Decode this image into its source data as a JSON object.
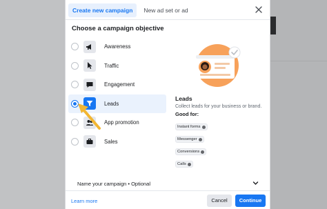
{
  "tabs": [
    {
      "label": "Create new campaign",
      "active": true
    },
    {
      "label": "New ad set or ad",
      "active": false
    }
  ],
  "section_title": "Choose a campaign objective",
  "objectives": [
    {
      "label": "Awareness",
      "icon": "megaphone-icon",
      "selected": false
    },
    {
      "label": "Traffic",
      "icon": "cursor-icon",
      "selected": false
    },
    {
      "label": "Engagement",
      "icon": "chat-bubble-icon",
      "selected": false
    },
    {
      "label": "Leads",
      "icon": "funnel-icon",
      "selected": true
    },
    {
      "label": "App promotion",
      "icon": "people-icon",
      "selected": false
    },
    {
      "label": "Sales",
      "icon": "briefcase-icon",
      "selected": false
    }
  ],
  "detail": {
    "title": "Leads",
    "description": "Collect leads for your business or brand.",
    "good_for_label": "Good for:",
    "chips": [
      "Instant forms",
      "Messenger",
      "Conversions",
      "Calls"
    ]
  },
  "name_row_label": "Name your campaign • Optional",
  "footer": {
    "learn_more": "Learn more",
    "cancel": "Cancel",
    "continue": "Continue"
  },
  "colors": {
    "accent": "#1877f2",
    "illustration_orange": "#f7a15a",
    "annotation_arrow": "#f2b632"
  }
}
